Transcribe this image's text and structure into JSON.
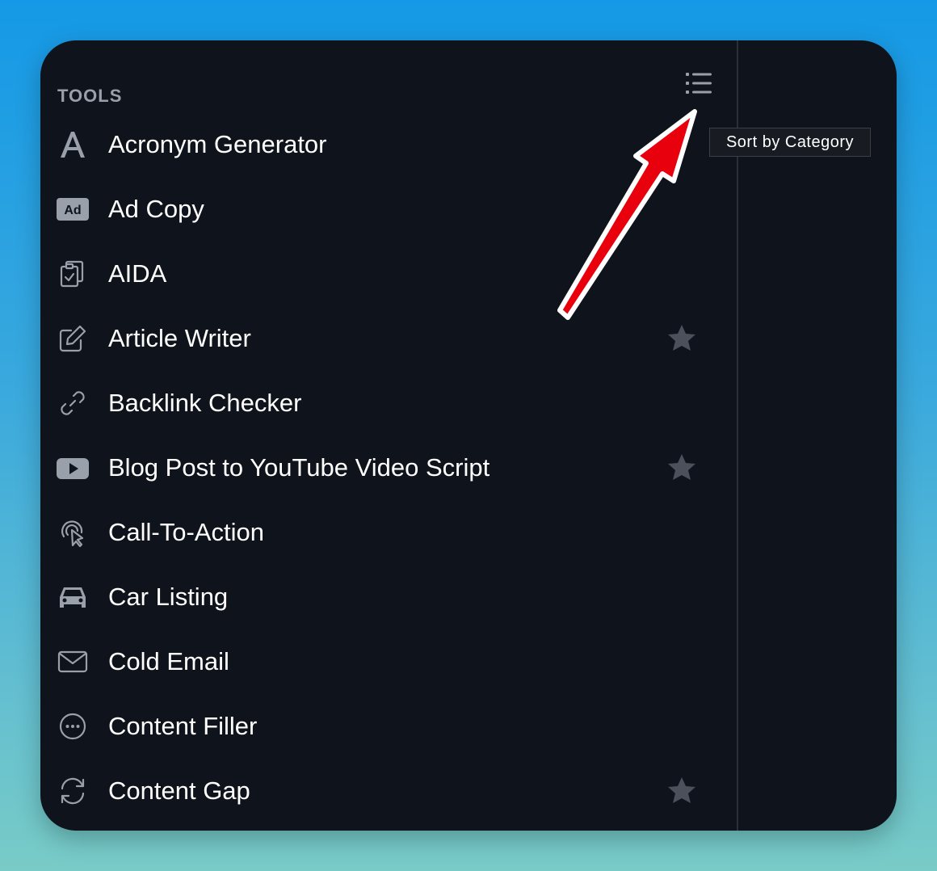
{
  "panel": {
    "section_title": "TOOLS",
    "sort_tooltip": "Sort by Category"
  },
  "tools": [
    {
      "label": "Acronym Generator",
      "icon": "letter-a-icon",
      "favorite": false
    },
    {
      "label": "Ad Copy",
      "icon": "ad-badge-icon",
      "favorite": false
    },
    {
      "label": "AIDA",
      "icon": "clipboard-check-icon",
      "favorite": false
    },
    {
      "label": "Article Writer",
      "icon": "pencil-square-icon",
      "favorite": true
    },
    {
      "label": "Backlink Checker",
      "icon": "link-icon",
      "favorite": false
    },
    {
      "label": "Blog Post to YouTube Video Script",
      "icon": "youtube-icon",
      "favorite": true
    },
    {
      "label": "Call-To-Action",
      "icon": "cursor-click-icon",
      "favorite": false
    },
    {
      "label": "Car Listing",
      "icon": "car-icon",
      "favorite": false
    },
    {
      "label": "Cold Email",
      "icon": "envelope-icon",
      "favorite": false
    },
    {
      "label": "Content Filler",
      "icon": "ellipsis-circle-icon",
      "favorite": false
    },
    {
      "label": "Content Gap",
      "icon": "refresh-icon",
      "favorite": true
    }
  ],
  "colors": {
    "panel_bg": "#0f131b",
    "text": "#ffffff",
    "muted": "#9aa0aa",
    "star": "#4b505a",
    "annotation_arrow": "#e8000c"
  }
}
